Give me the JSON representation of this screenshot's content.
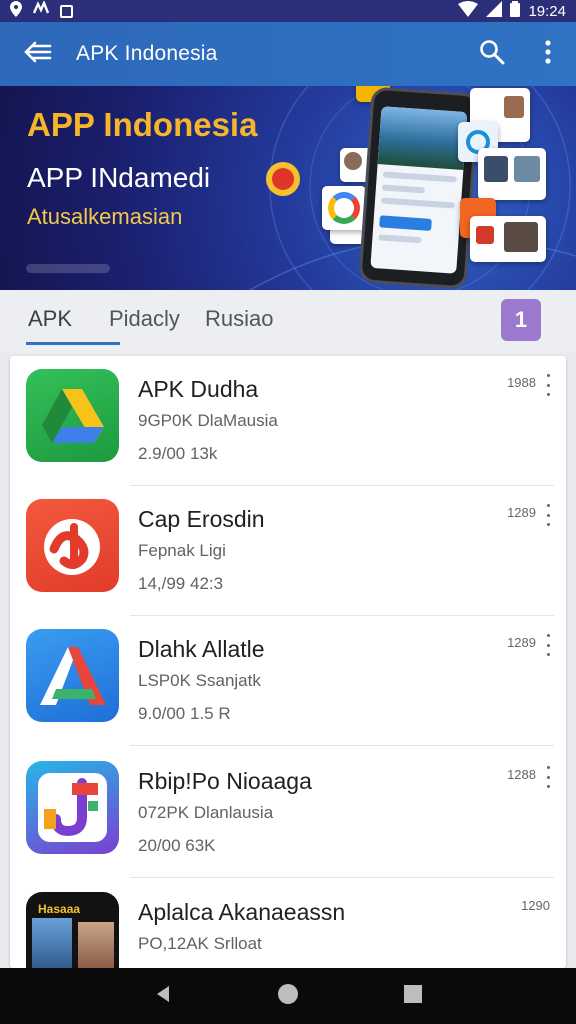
{
  "status_bar": {
    "time": "19:24"
  },
  "app_bar": {
    "title": "APK Indonesia"
  },
  "banner": {
    "title": "APP Indonesia",
    "subtitle_1": "APP INdamedi",
    "subtitle_2": "Atusalkemasian"
  },
  "tabs": [
    {
      "label": "APK",
      "active": true
    },
    {
      "label": "Pidacly",
      "active": false
    },
    {
      "label": "Rusiao",
      "active": false
    }
  ],
  "tab_badge": "1",
  "apps": [
    {
      "name": "APK Dudha",
      "developer": "9GP0K DlaMausia",
      "meta": "2.9/00  13k",
      "count": "1988",
      "icon": "drive-triangle-icon",
      "bg": "#27a74a"
    },
    {
      "name": "Cap Erosdin",
      "developer": "Fepnak Ligi",
      "meta": "14,/99  42:3",
      "count": "1289",
      "icon": "red-swirl-icon",
      "bg": "#ef4a35"
    },
    {
      "name": "Dlahk Allatle",
      "developer": "LSP0K Ssanjatk",
      "meta": "9.0/00  1.5 R",
      "count": "1289",
      "icon": "colored-a-icon",
      "bg": "#2c86e6"
    },
    {
      "name": "Rbip!Po Nioaaga",
      "developer": "072PK Dlanlausia",
      "meta": "20/00  63K",
      "count": "1288",
      "icon": "colored-j-icon",
      "bg": "#7a3fd0"
    },
    {
      "name": "Aplalca Akanaeassn",
      "developer": "PO,12AK Srlloat",
      "meta": "",
      "count": "1290",
      "icon": "photo-thumbnail-icon",
      "bg": "#121212",
      "icon_text": "Hasaaa"
    }
  ],
  "colors": {
    "app_bar": "#2f6fc0",
    "status_bar": "#2b2f79",
    "accent": "#2f73c4",
    "badge": "#9b79cf",
    "banner_title": "#f6b52a"
  }
}
